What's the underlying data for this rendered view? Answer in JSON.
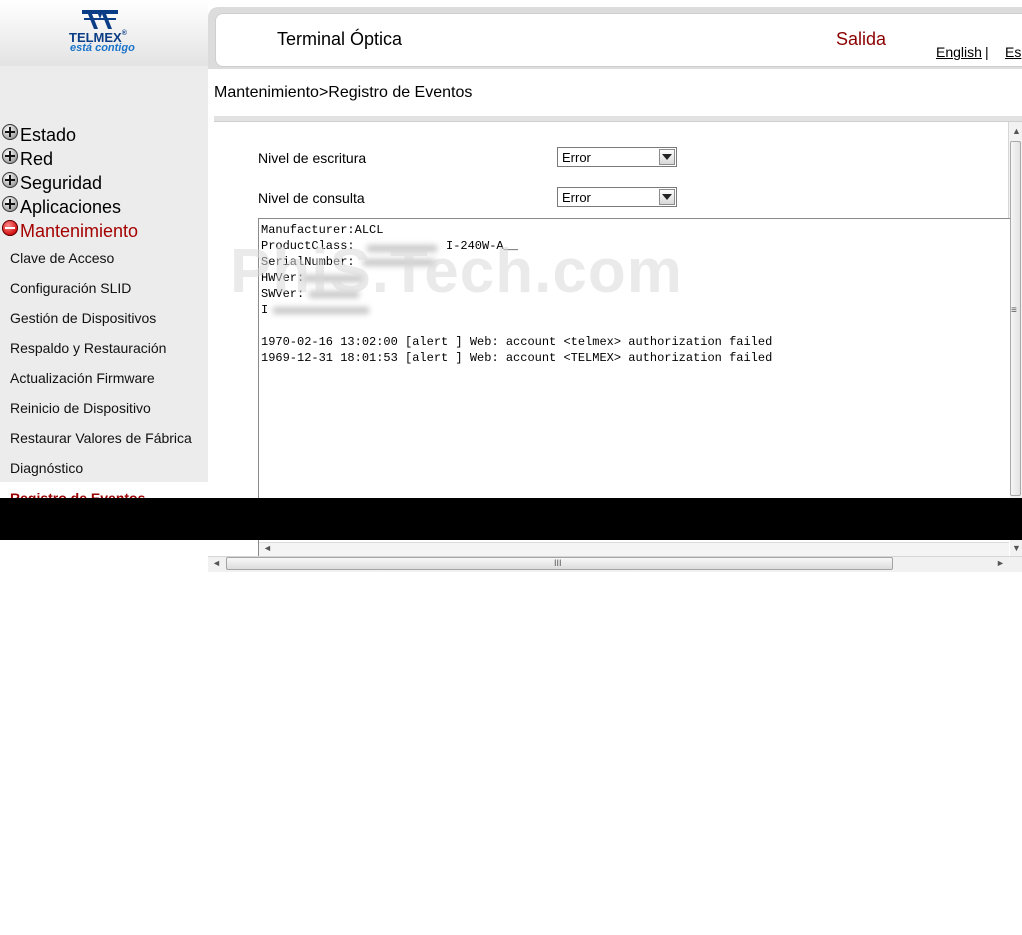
{
  "brand": {
    "name": "TELMEX",
    "tagline": "está contigo",
    "color": "#0a3d86"
  },
  "header": {
    "title": "Terminal Óptica",
    "exit_label": "Salida",
    "lang_en": "English",
    "lang_sep": "|",
    "lang_es": "Es"
  },
  "sidebar": {
    "menus": [
      {
        "label": "Estado",
        "state": "collapsed"
      },
      {
        "label": "Red",
        "state": "collapsed"
      },
      {
        "label": "Seguridad",
        "state": "collapsed"
      },
      {
        "label": "Aplicaciones",
        "state": "collapsed"
      },
      {
        "label": "Mantenimiento",
        "state": "expanded"
      }
    ],
    "submenu": [
      "Clave de Acceso",
      "Configuración SLID",
      "Gestión de Dispositivos",
      "Respaldo y Restauración",
      "Actualización Firmware",
      "Reinicio de Dispositivo",
      "Restaurar Valores de Fábrica",
      "Diagnóstico",
      "Registro de Eventos"
    ],
    "active_submenu": "Registro de Eventos"
  },
  "breadcrumb": "Mantenimiento>Registro de Eventos",
  "form": {
    "write_level": {
      "label": "Nivel de escritura",
      "value": "Error"
    },
    "read_level": {
      "label": "Nivel de consulta",
      "value": "Error"
    }
  },
  "log": {
    "header_lines": [
      "Manufacturer:ALCL",
      "ProductClass:",
      "SerialNumber:",
      "HWVer:",
      "SWVer:",
      "I"
    ],
    "product_model": "I-240W-A__",
    "entries": [
      "1970-02-16 13:02:00 [alert ] Web: account <telmex> authorization failed",
      "1969-12-31 18:01:53 [alert ] Web: account <TELMEX> authorization failed"
    ]
  },
  "watermark": "PhiS.Tech.com",
  "colors": {
    "accent_red": "#8b0000",
    "sidebar_bg": "#ececec"
  }
}
